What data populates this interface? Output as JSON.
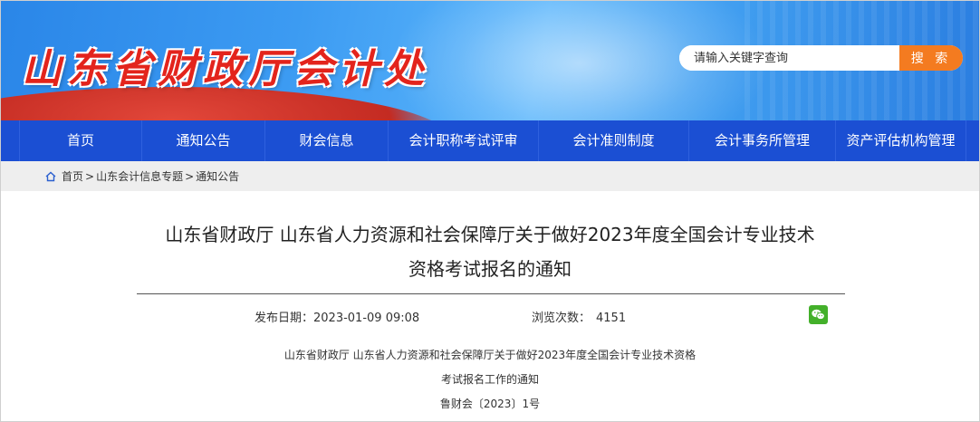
{
  "header": {
    "site_title": "山东省财政厅会计处",
    "search_placeholder": "请输入关键字查询",
    "search_button": "搜 索"
  },
  "nav": {
    "items": [
      {
        "label": "首页"
      },
      {
        "label": "通知公告"
      },
      {
        "label": "财会信息"
      },
      {
        "label": "会计职称考试评审"
      },
      {
        "label": "会计准则制度"
      },
      {
        "label": "会计事务所管理"
      },
      {
        "label": "资产评估机构管理"
      }
    ]
  },
  "breadcrumb": {
    "home": "首页",
    "sep": ">",
    "level1": "山东会计信息专题",
    "level2": "通知公告"
  },
  "article": {
    "title_line1": "山东省财政厅 山东省人力资源和社会保障厅关于做好2023年度全国会计专业技术",
    "title_line2": "资格考试报名的通知",
    "publish_label": "发布日期：",
    "publish_date": "2023-01-09 09:08",
    "views_label": "浏览次数：",
    "views_count": "4151",
    "body_line1": "山东省财政厅  山东省人力资源和社会保障厅关于做好2023年度全国会计专业技术资格",
    "body_line2": "考试报名工作的通知",
    "body_line3": "鲁财会〔2023〕1号"
  },
  "colors": {
    "nav_bg": "#1b4fd3",
    "search_button": "#f47b20",
    "logo_red": "#e3241c",
    "wechat_green": "#43b02a"
  }
}
